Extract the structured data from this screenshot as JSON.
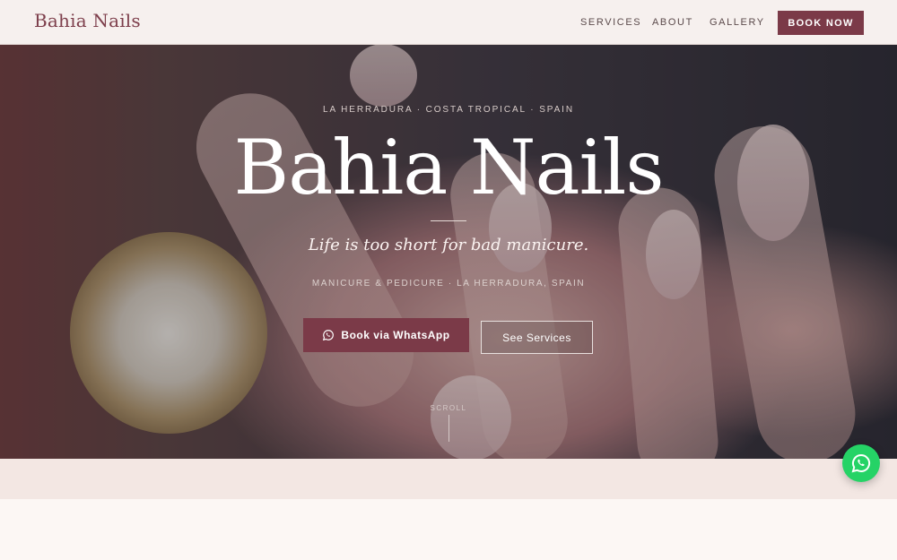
{
  "header": {
    "brand": "Bahia Nails",
    "nav": [
      "SERVICES",
      "ABOUT",
      "GALLERY"
    ],
    "cta": "BOOK NOW"
  },
  "hero": {
    "eyebrow": "LA HERRADURA · COSTA TROPICAL · SPAIN",
    "title": "Bahia Nails",
    "tagline": "Life is too short for bad manicure.",
    "subline": "MANICURE & PEDICURE · LA HERRADURA, SPAIN",
    "primary_button": "Book via WhatsApp",
    "secondary_button": "See Services",
    "scroll_label": "SCROLL"
  },
  "colors": {
    "accent": "#7b3a48",
    "whatsapp": "#25d366"
  },
  "icons": {
    "whatsapp": "whatsapp-icon"
  }
}
